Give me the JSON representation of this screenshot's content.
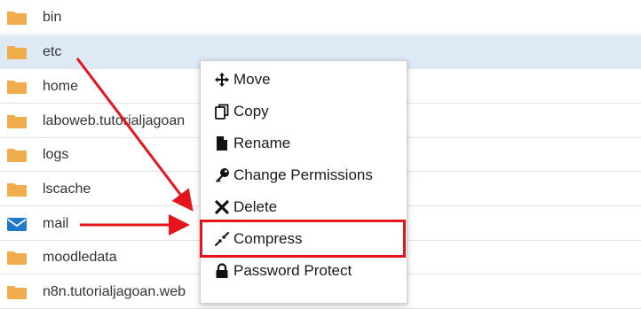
{
  "file_list": {
    "rows": [
      {
        "name": "bin",
        "icon": "folder-icon"
      },
      {
        "name": "etc",
        "icon": "folder-icon",
        "selected": true
      },
      {
        "name": "home",
        "icon": "folder-icon"
      },
      {
        "name": "laboweb.tutorialjagoan",
        "icon": "folder-icon"
      },
      {
        "name": "logs",
        "icon": "folder-icon"
      },
      {
        "name": "lscache",
        "icon": "folder-icon"
      },
      {
        "name": "mail",
        "icon": "mail-icon"
      },
      {
        "name": "moodledata",
        "icon": "folder-icon"
      },
      {
        "name": "n8n.tutorialjagoan.web",
        "icon": "folder-icon"
      }
    ]
  },
  "context_menu": {
    "items": [
      {
        "label": "Move",
        "icon": "move-icon"
      },
      {
        "label": "Copy",
        "icon": "copy-icon"
      },
      {
        "label": "Rename",
        "icon": "file-icon"
      },
      {
        "label": "Change Permissions",
        "icon": "key-icon"
      },
      {
        "label": "Delete",
        "icon": "close-icon"
      },
      {
        "label": "Compress",
        "icon": "compress-icon"
      },
      {
        "label": "Password Protect",
        "icon": "lock-icon"
      }
    ]
  },
  "colors": {
    "folder": "#f0ad4e",
    "mail": "#1f78c8",
    "selected_row": "#dde9f5",
    "annotation_red": "#e8141b"
  }
}
